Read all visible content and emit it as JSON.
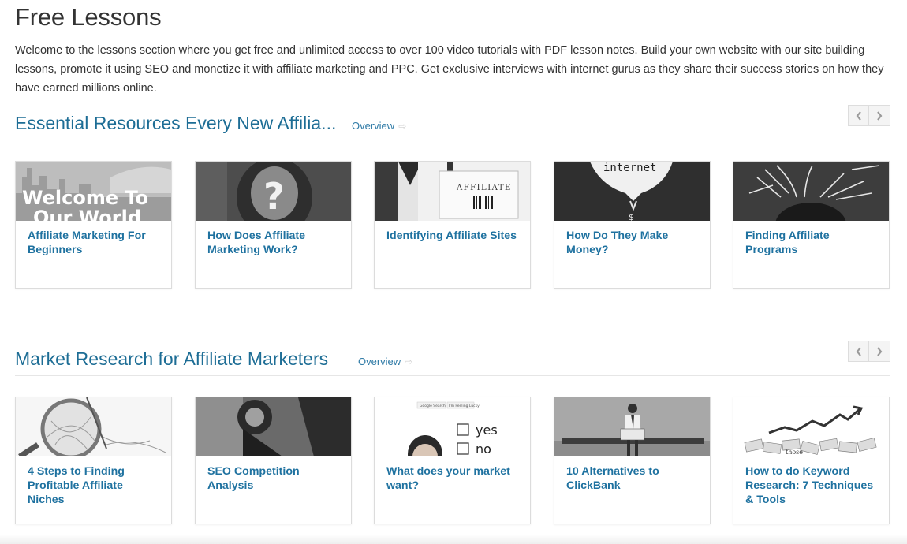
{
  "page": {
    "title": "Free Lessons",
    "intro": "Welcome to the lessons section where you get free and unlimited access to over 100 video tutorials with PDF lesson notes. Build your own website with our site building lessons, promote it using SEO and monetize it with affiliate marketing and PPC. Get exclusive interviews with internet gurus as they share their success stories on how they have earned millions online."
  },
  "sections": [
    {
      "title": "Essential Resources Every New Affilia...",
      "overview_label": "Overview",
      "cards": [
        {
          "title": "Affiliate Marketing For Beginners",
          "image_text": [
            "Welcome To",
            "Our World"
          ]
        },
        {
          "title": "How Does Affiliate Marketing Work?"
        },
        {
          "title": "Identifying Affiliate Sites",
          "image_text": [
            "AFFILIATE"
          ]
        },
        {
          "title": "How Do They Make Money?",
          "image_text": [
            "internet"
          ]
        },
        {
          "title": "Finding Affiliate Programs"
        }
      ]
    },
    {
      "title": "Market Research for Affiliate Marketers",
      "overview_label": "Overview",
      "cards": [
        {
          "title": "4 Steps to Finding Profitable Affiliate Niches"
        },
        {
          "title": "SEO Competition Analysis"
        },
        {
          "title": "What does your market want?",
          "image_text": [
            "yes",
            "no",
            "Google Search",
            "I'm Feeling Lucky"
          ]
        },
        {
          "title": "10 Alternatives to ClickBank"
        },
        {
          "title": "How to do Keyword Research: 7 Techniques & Tools",
          "image_text": [
            "those"
          ]
        }
      ]
    }
  ],
  "colors": {
    "heading": "#1d6d95",
    "link": "#1f72a0",
    "text": "#333333"
  },
  "icons": {
    "overview": "arrow-right-icon",
    "prev": "chevron-left-icon",
    "next": "chevron-right-icon"
  }
}
